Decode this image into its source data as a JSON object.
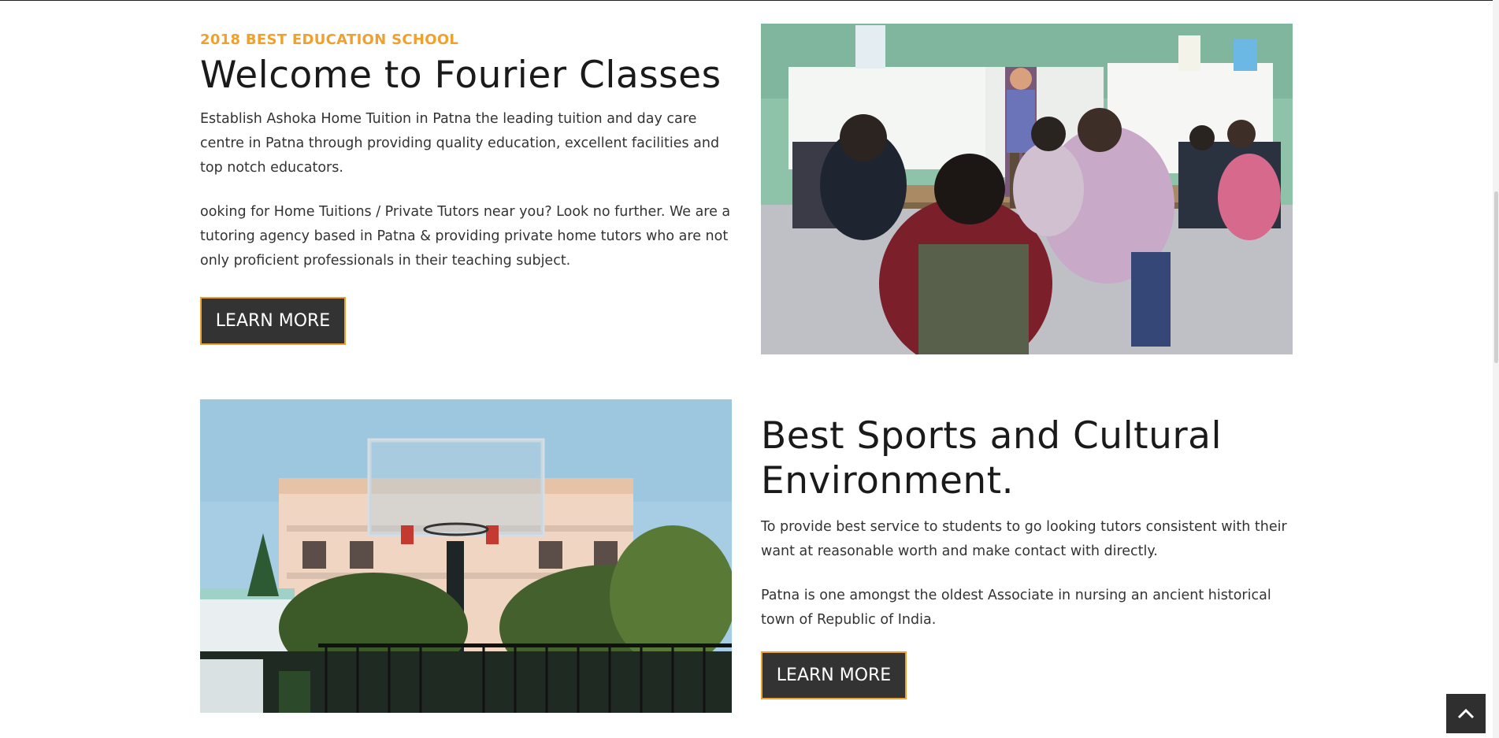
{
  "section1": {
    "tagline": "2018 BEST EDUCATION SCHOOL",
    "title": "Welcome to Fourier Classes",
    "para1": "Establish Ashoka Home Tuition in Patna the leading tuition and day care centre in Patna through providing quality education, excellent facilities and top notch educators.",
    "para2": "ooking for Home Tuitions / Private Tutors near you? Look no further. We are a tutoring agency based in Patna & providing private home tutors who are not only proficient professionals in their teaching subject.",
    "button_label": "LEARN MORE"
  },
  "section2": {
    "title": "Best Sports and Cultural Environment.",
    "para1": "To provide best service to students to go looking tutors consistent with their want at reasonable worth and make contact with directly.",
    "para2": "Patna is one amongst the oldest Associate in nursing an ancient historical town of Republic of India.",
    "button_label": "LEARN MORE"
  },
  "icons": {
    "back_to_top": "chevron-up-icon"
  },
  "colors": {
    "accent": "#f0a02c",
    "button_bg": "#333333",
    "heading": "#1a1a1a"
  }
}
